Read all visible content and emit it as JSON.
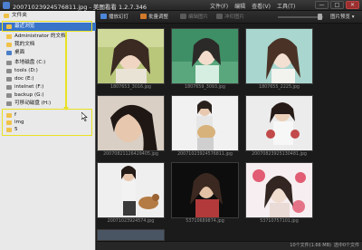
{
  "window": {
    "title": "20071023924576811.jpg - 美图看看 1.2.7.346",
    "menus": [
      "文件(F)",
      "编辑",
      "查看(V)",
      "工具(T)"
    ],
    "buttons": [
      "—",
      "□",
      "✕"
    ]
  },
  "sidebar": {
    "items": [
      {
        "label": "文件夹",
        "icon": "folder-icon"
      },
      {
        "label": "最近浏览",
        "icon": "folder-icon"
      },
      {
        "label": "Administrator 的文档",
        "icon": "folder-icon"
      },
      {
        "label": "我的文档",
        "icon": "folder-icon"
      },
      {
        "label": "桌面",
        "icon": "desktop-icon"
      },
      {
        "label": "本地磁盘 (C:)",
        "icon": "drive-icon"
      },
      {
        "label": "tools (D:)",
        "icon": "drive-icon"
      },
      {
        "label": "doc (E:)",
        "icon": "drive-icon"
      },
      {
        "label": "intelnet (F:)",
        "icon": "drive-icon"
      },
      {
        "label": "backup (G:)",
        "icon": "drive-icon"
      },
      {
        "label": "可移动磁盘 (H:)",
        "icon": "drive-icon"
      },
      {
        "label": "f",
        "icon": "folder-icon"
      },
      {
        "label": "img",
        "icon": "folder-icon"
      },
      {
        "label": "5",
        "icon": "folder-icon"
      }
    ]
  },
  "toolbar": {
    "slideshow": "播放幻灯",
    "batch": "批量调整",
    "edit": "编辑图片",
    "print": "冲印图片",
    "view_mode": "图片预览"
  },
  "thumbnails": [
    {
      "caption": "1807653_3016.jpg"
    },
    {
      "caption": "1807659_3093.jpg"
    },
    {
      "caption": "1807655_2225.jpg"
    },
    {
      "caption": "20070821126429405.jpg"
    },
    {
      "caption": "20071023924576811.jpg"
    },
    {
      "caption": "20070823925130481.jpg"
    },
    {
      "caption": "20071023924574.jpg"
    },
    {
      "caption": "53710689874.jpg"
    },
    {
      "caption": "53710757101.jpg"
    }
  ],
  "status": {
    "count": "10个文件(1.66 MB)",
    "selected": "选中0个文件"
  },
  "colors": {
    "highlight": "#e8e221",
    "selection": "#3874c8"
  }
}
